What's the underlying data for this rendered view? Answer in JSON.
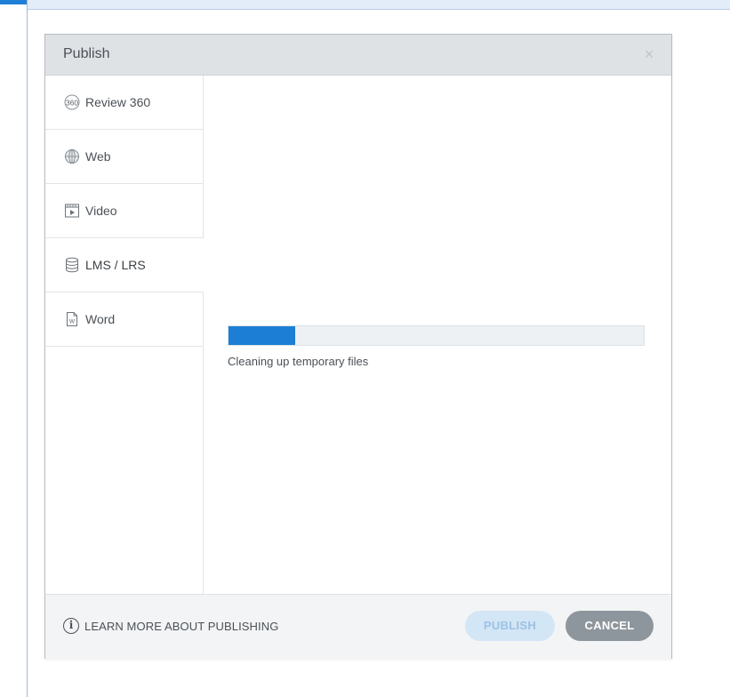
{
  "dialog": {
    "title": "Publish",
    "close_glyph": "×"
  },
  "sidebar": {
    "items": [
      {
        "label": "Review 360",
        "icon": "review-360-icon",
        "active": false
      },
      {
        "label": "Web",
        "icon": "globe-icon",
        "active": false
      },
      {
        "label": "Video",
        "icon": "video-icon",
        "active": false
      },
      {
        "label": "LMS / LRS",
        "icon": "database-icon",
        "active": true
      },
      {
        "label": "Word",
        "icon": "word-document-icon",
        "active": false
      }
    ]
  },
  "progress": {
    "fraction": 0.16,
    "status": "Cleaning up temporary files"
  },
  "footer": {
    "learn_more": "LEARN MORE ABOUT PUBLISHING",
    "publish_label": "PUBLISH",
    "cancel_label": "CANCEL"
  },
  "colors": {
    "accent": "#1c7fd5",
    "header_bg": "#dfe2e5",
    "cancel_bg": "#8e969d",
    "publish_disabled_bg": "#d3e6f6"
  }
}
